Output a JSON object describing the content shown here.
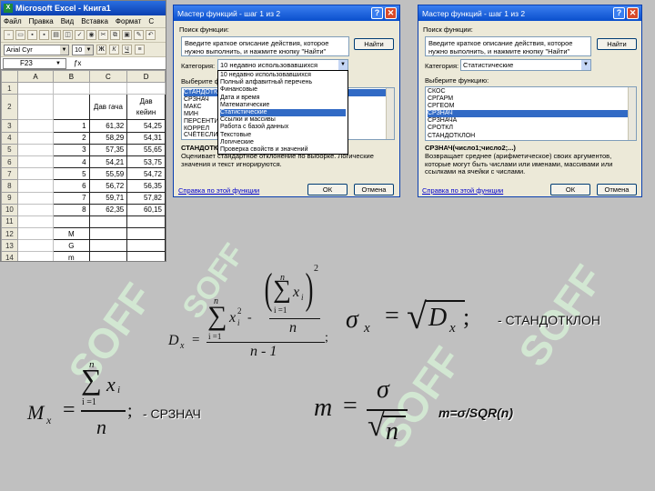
{
  "excel": {
    "title": "Microsoft Excel - Книга1",
    "menu": [
      "Файл",
      "Правка",
      "Вид",
      "Вставка",
      "Формат",
      "С"
    ],
    "font_name": "Arial Cyr",
    "font_size": "10",
    "fmt_buttons": [
      "Ж",
      "К",
      "Ч"
    ],
    "name_box": "F23",
    "columns": [
      "A",
      "B",
      "C",
      "D"
    ],
    "rows": [
      {
        "n": "1",
        "a": "",
        "b": "",
        "c": "",
        "d": ""
      },
      {
        "n": "2",
        "a": "",
        "b": "",
        "c": "Дав гача",
        "d": "Дав кейин"
      },
      {
        "n": "3",
        "a": "",
        "b": "1",
        "c": "61,32",
        "d": "54,25"
      },
      {
        "n": "4",
        "a": "",
        "b": "2",
        "c": "58,29",
        "d": "54,31"
      },
      {
        "n": "5",
        "a": "",
        "b": "3",
        "c": "57,35",
        "d": "55,65"
      },
      {
        "n": "6",
        "a": "",
        "b": "4",
        "c": "54,21",
        "d": "53,75"
      },
      {
        "n": "7",
        "a": "",
        "b": "5",
        "c": "55,59",
        "d": "54,72"
      },
      {
        "n": "8",
        "a": "",
        "b": "6",
        "c": "56,72",
        "d": "56,35"
      },
      {
        "n": "9",
        "a": "",
        "b": "7",
        "c": "59,71",
        "d": "57,82"
      },
      {
        "n": "10",
        "a": "",
        "b": "8",
        "c": "62,35",
        "d": "60,15"
      },
      {
        "n": "11",
        "a": "",
        "b": "",
        "c": "",
        "d": ""
      },
      {
        "n": "12",
        "a": "",
        "b": "M",
        "c": "",
        "d": ""
      },
      {
        "n": "13",
        "a": "",
        "b": "G",
        "c": "",
        "d": ""
      },
      {
        "n": "14",
        "a": "",
        "b": "m",
        "c": "",
        "d": ""
      },
      {
        "n": "15",
        "a": "",
        "b": "",
        "c": "",
        "d": ""
      }
    ]
  },
  "dialog1": {
    "title": "Мастер функций - шаг 1 из 2",
    "search_label": "Поиск функции:",
    "search_text": "Введите краткое описание действия, которое нужно выполнить, и нажмите кнопку \"Найти\"",
    "find_button": "Найти",
    "category_label": "Категория:",
    "category_value": "10 недавно использовавшихся",
    "choose_label": "Выберите функ",
    "func_list": [
      "СТАНДОТКЛ",
      "СРЗНАЧ",
      "МАКС",
      "МИН",
      "ПЕРСЕНТИЛ",
      "КОРРЕЛ",
      "СЧЁТЕСЛИ"
    ],
    "dropdown": [
      "10 недавно использовавшихся",
      "Полный алфавитный перечень",
      "Финансовые",
      "Дата и время",
      "Математические",
      "Статистические",
      "Ссылки и массивы",
      "Работа с базой данных",
      "Текстовые",
      "Логические",
      "Проверка свойств и значений"
    ],
    "func_name": "СТАНДОТК",
    "description": "Оценивает стандартное отклонение по выборке. Логические значения и текст игнорируются.",
    "help_link": "Справка по этой функции",
    "ok": "ОК",
    "cancel": "Отмена"
  },
  "dialog2": {
    "title": "Мастер функций - шаг 1 из 2",
    "search_label": "Поиск функции:",
    "search_text": "Введите краткое описание действия, которое нужно выполнить, и нажмите кнопку \"Найти\"",
    "find_button": "Найти",
    "category_label": "Категория:",
    "category_value": "Статистические",
    "choose_label": "Выберите функцию:",
    "func_list": [
      "СКОС",
      "СРГАРМ",
      "СРГЕОМ",
      "СРЗНАЧ",
      "СРЗНАЧА",
      "СРОТКЛ",
      "СТАНДОТКЛОН"
    ],
    "func_sig": "СРЗНАЧ(число1;число2;...)",
    "description": "Возвращает среднее (арифметическое) своих аргументов, которые могут быть числами или именами, массивами или ссылками на ячейки с числами.",
    "help_link": "Справка по этой функции",
    "ok": "ОК",
    "cancel": "Отмена"
  },
  "formulas": {
    "dx": {
      "lhs": "D",
      "sub": "x",
      "eq": "=",
      "sum": "∑",
      "top_n": "n",
      "bot": "i =1",
      "xi": "x",
      "i": "i",
      "sq": "2",
      "minus": "-",
      "den_n": "n",
      "den": "n - 1",
      "semi": ";"
    },
    "sigma": {
      "lhs": "σ",
      "sub": "x",
      "eq": "=",
      "D": "D",
      "semi": ";",
      "note": "- СТАНДОТКЛОН"
    },
    "mx": {
      "lhs": "M",
      "sub": "x",
      "eq": "=",
      "n": "n",
      "bot": "i =1",
      "semi": ";",
      "note": "- СРЗНАЧ"
    },
    "m": {
      "lhs": "m",
      "eq": "=",
      "sigma": "σ",
      "n": "n",
      "note": "m=σ/SQR(n)"
    }
  },
  "watermark": "SOFF"
}
